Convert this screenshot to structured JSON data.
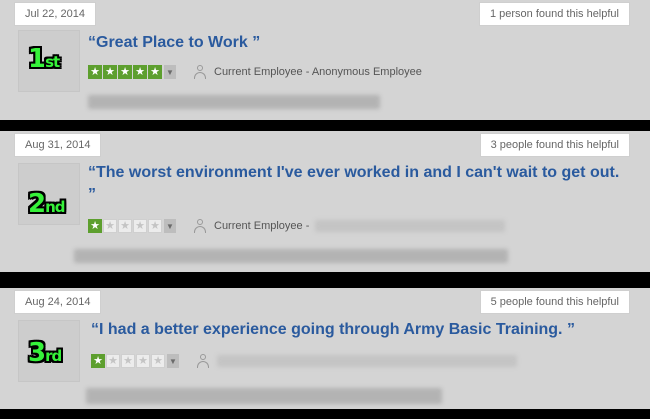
{
  "reviews": [
    {
      "date": "Jul 22, 2014",
      "helpful": "1 person found this helpful",
      "rank_number": "1",
      "rank_suffix": "st",
      "title": "“Great Place to Work ”",
      "rating": 5,
      "employee": "Current Employee - Anonymous Employee"
    },
    {
      "date": "Aug 31, 2014",
      "helpful": "3 people found this helpful",
      "rank_number": "2",
      "rank_suffix": "nd",
      "title": "“The worst environment I've ever worked in and I can't wait to get out. ”",
      "rating": 1,
      "employee": "Current Employee -"
    },
    {
      "date": "Aug 24, 2014",
      "helpful": "5 people found this helpful",
      "rank_number": "3",
      "rank_suffix": "rd",
      "title": "“I had a better experience going through Army Basic Training. ”",
      "rating": 1,
      "employee": ""
    }
  ],
  "icons": {
    "star_filled": "star-filled-icon",
    "star_empty": "star-empty-icon",
    "dropdown": "dropdown-arrow-icon",
    "user": "user-icon"
  },
  "colors": {
    "title_blue": "#2a5a9e",
    "star_green": "#5d9f2e",
    "rank_green": "#36f23a",
    "separator": "#000000"
  }
}
